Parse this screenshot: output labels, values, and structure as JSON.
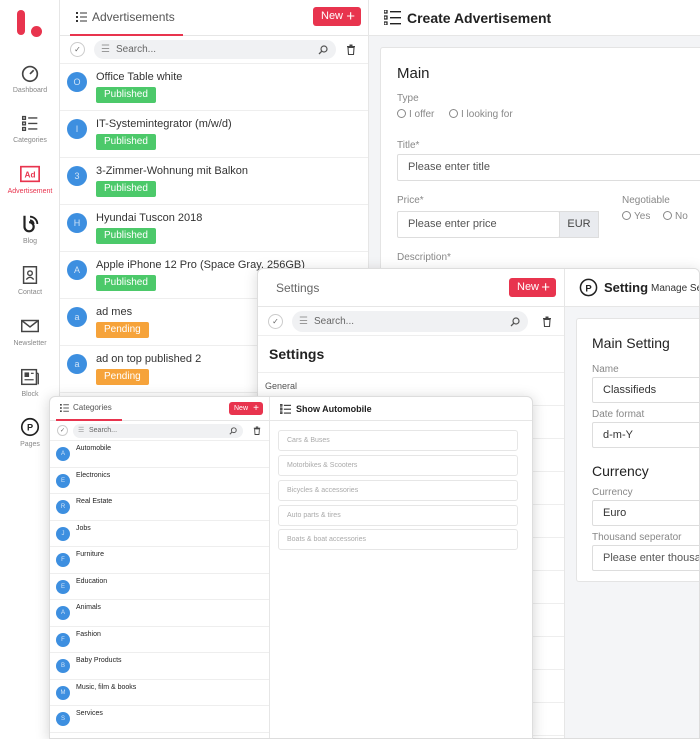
{
  "app": {
    "accent": "#e8344e",
    "logo": "logo-mark"
  },
  "sidebar": {
    "items": [
      {
        "label": "Dashboard",
        "icon": "gauge-icon"
      },
      {
        "label": "Categories",
        "icon": "list-icon"
      },
      {
        "label": "Advertisement",
        "icon": "ad-icon",
        "active": true
      },
      {
        "label": "Blog",
        "icon": "blog-icon"
      },
      {
        "label": "Contact",
        "icon": "contact-icon"
      },
      {
        "label": "Newsletter",
        "icon": "mail-icon"
      },
      {
        "label": "Block",
        "icon": "newspaper-icon"
      },
      {
        "label": "Pages",
        "icon": "pages-icon"
      }
    ]
  },
  "ads_panel": {
    "tab": "Advertisements",
    "new_label": "New",
    "search_placeholder": "Search...",
    "items": [
      {
        "initial": "O",
        "title": "Office Table white",
        "status": "Published"
      },
      {
        "initial": "I",
        "title": "IT-Systemintegrator (m/w/d)",
        "status": "Published"
      },
      {
        "initial": "3",
        "title": "3-Zimmer-Wohnung mit Balkon",
        "status": "Published"
      },
      {
        "initial": "H",
        "title": "Hyundai Tuscon 2018",
        "status": "Published"
      },
      {
        "initial": "A",
        "title": "Apple iPhone 12 Pro (Space Gray, 256GB)",
        "status": "Published"
      },
      {
        "initial": "a",
        "title": "ad mes",
        "status": "Pending"
      },
      {
        "initial": "a",
        "title": "ad on top published 2",
        "status": "Pending"
      }
    ]
  },
  "create": {
    "title": "Create Advertisement",
    "section": "Main",
    "type_label": "Type",
    "type_options": [
      "I offer",
      "I looking for"
    ],
    "title_label": "Title*",
    "title_placeholder": "Please enter title",
    "price_label": "Price*",
    "price_placeholder": "Please enter price",
    "currency": "EUR",
    "negotiable_label": "Negotiable",
    "negotiable_options": [
      "Yes",
      "No"
    ],
    "description_label": "Description*"
  },
  "settings": {
    "tab": "Settings",
    "new_label": "New",
    "search_placeholder": "Search...",
    "heading": "Settings",
    "group": "General",
    "detail_title": "Setting",
    "detail_subtitle": "Manage Se",
    "main_setting": "Main Setting",
    "name_label": "Name",
    "name_value": "Classifieds",
    "date_format_label": "Date format",
    "date_format_value": "d-m-Y",
    "currency_heading": "Currency",
    "currency_label": "Currency",
    "currency_value": "Euro",
    "thousand_label": "Thousand seperator",
    "thousand_placeholder": "Please enter thousan"
  },
  "categories": {
    "tab": "Categories",
    "new_label": "New",
    "search_placeholder": "Search...",
    "items": [
      {
        "initial": "A",
        "name": "Automobile"
      },
      {
        "initial": "E",
        "name": "Electronics"
      },
      {
        "initial": "R",
        "name": "Real Estate"
      },
      {
        "initial": "J",
        "name": "Jobs"
      },
      {
        "initial": "F",
        "name": "Furniture"
      },
      {
        "initial": "E",
        "name": "Education"
      },
      {
        "initial": "A",
        "name": "Animals"
      },
      {
        "initial": "F",
        "name": "Fashion"
      },
      {
        "initial": "B",
        "name": "Baby Products"
      },
      {
        "initial": "M",
        "name": "Music, film & books"
      },
      {
        "initial": "S",
        "name": "Services"
      }
    ],
    "detail_title": "Show Automobile",
    "subcategories": [
      "Cars & Buses",
      "Motorbikes & Scooters",
      "Bicycles & accessories",
      "Auto parts & tires",
      "Boats & boat accessories"
    ]
  }
}
